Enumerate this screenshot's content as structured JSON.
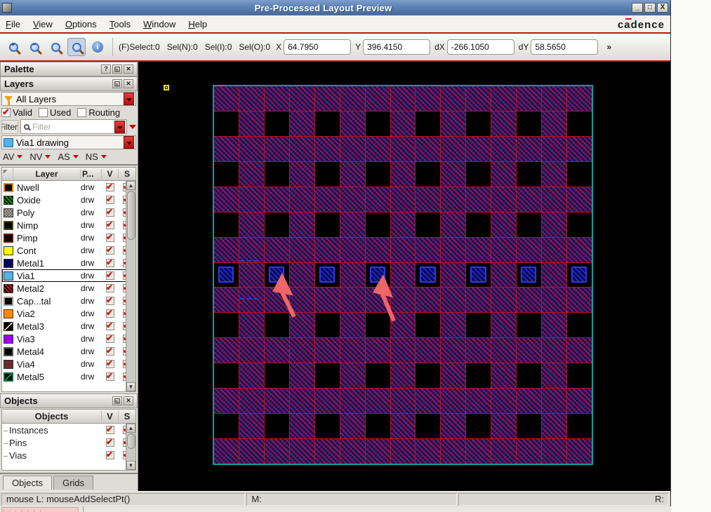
{
  "window": {
    "title": "Pre-Processed Layout Preview",
    "brand": "cadence"
  },
  "titlebar_buttons": {
    "minimize": "_",
    "maximize": "□",
    "close": "X"
  },
  "menu": {
    "items": [
      "File",
      "View",
      "Options",
      "Tools",
      "Window",
      "Help"
    ]
  },
  "toolbar": {
    "icons": [
      "zoom-in",
      "zoom-out",
      "zoom-area",
      "zoom-fit",
      "info"
    ],
    "status_counters": [
      "(F)Select:0",
      "Sel(N):0",
      "Sel(I):0",
      "Sel(O):0"
    ],
    "coord_fields": [
      {
        "label": "X",
        "value": "64.7950"
      },
      {
        "label": "Y",
        "value": "396.4150"
      },
      {
        "label": "dX",
        "value": "-266.1050"
      },
      {
        "label": "dY",
        "value": "58.5650"
      }
    ],
    "overflow_label": "»"
  },
  "palette": {
    "title": "Palette",
    "header_buttons": [
      "?",
      "◱",
      "✕"
    ],
    "layers_panel": {
      "title": "Layers",
      "header_buttons": [
        "◱",
        "✕"
      ],
      "layer_filter_value": "All Layers",
      "checkboxes": [
        {
          "label": "Valid",
          "checked": true
        },
        {
          "label": "Used",
          "checked": false
        },
        {
          "label": "Routing",
          "checked": false
        }
      ],
      "filter_side_label": "Filter",
      "filter_placeholder": "Filter",
      "active_layer_value": "Via1 drawing",
      "quick_buttons": [
        "AV",
        "NV",
        "AS",
        "NS"
      ],
      "table": {
        "headers": [
          "Layer",
          "P...",
          "V",
          "S"
        ],
        "rows": [
          {
            "name": "Nwell",
            "purpose": "drw",
            "v": true,
            "s": true,
            "swatch": "nwell"
          },
          {
            "name": "Oxide",
            "purpose": "drw",
            "v": true,
            "s": true,
            "swatch": "oxide"
          },
          {
            "name": "Poly",
            "purpose": "drw",
            "v": true,
            "s": true,
            "swatch": "poly"
          },
          {
            "name": "Nimp",
            "purpose": "drw",
            "v": true,
            "s": true,
            "swatch": "nimp"
          },
          {
            "name": "Pimp",
            "purpose": "drw",
            "v": true,
            "s": true,
            "swatch": "pimp"
          },
          {
            "name": "Cont",
            "purpose": "drw",
            "v": true,
            "s": true,
            "swatch": "cont"
          },
          {
            "name": "Metal1",
            "purpose": "drw",
            "v": true,
            "s": true,
            "swatch": "metal1"
          },
          {
            "name": "Via1",
            "purpose": "drw",
            "v": true,
            "s": true,
            "swatch": "via1",
            "selected": true
          },
          {
            "name": "Metal2",
            "purpose": "drw",
            "v": true,
            "s": true,
            "swatch": "metal2"
          },
          {
            "name": "Cap...tal",
            "purpose": "drw",
            "v": true,
            "s": true,
            "swatch": "captal"
          },
          {
            "name": "Via2",
            "purpose": "drw",
            "v": true,
            "s": true,
            "swatch": "via2"
          },
          {
            "name": "Metal3",
            "purpose": "drw",
            "v": true,
            "s": true,
            "swatch": "metal3"
          },
          {
            "name": "Via3",
            "purpose": "drw",
            "v": true,
            "s": true,
            "swatch": "via3"
          },
          {
            "name": "Metal4",
            "purpose": "drw",
            "v": true,
            "s": true,
            "swatch": "metal4"
          },
          {
            "name": "Via4",
            "purpose": "drw",
            "v": true,
            "s": true,
            "swatch": "via4"
          },
          {
            "name": "Metal5",
            "purpose": "drw",
            "v": true,
            "s": true,
            "swatch": "metal5"
          }
        ]
      }
    },
    "objects_panel": {
      "title": "Objects",
      "header_buttons": [
        "◱",
        "✕"
      ],
      "table_headers": [
        "Objects",
        "V",
        "S"
      ],
      "rows": [
        {
          "name": "Instances",
          "v": true,
          "s": true
        },
        {
          "name": "Pins",
          "v": true,
          "s": true
        },
        {
          "name": "Vias",
          "v": true,
          "s": true
        }
      ]
    },
    "tabs": [
      {
        "label": "Objects",
        "active": true
      },
      {
        "label": "Grids",
        "active": false
      }
    ]
  },
  "canvas": {
    "grid": {
      "rows": 15,
      "cols": 15,
      "via_row": 8,
      "black_rule": "even-rows-odd-cols",
      "via_count": 8
    },
    "annotations": {
      "arrows_point_to_via_columns": [
        3,
        7
      ]
    },
    "colors": {
      "background": "#000000",
      "boundary": "#0a9f9f",
      "grid_lines": "#b01425",
      "hatch_base": "#181050",
      "via_outline": "#2a35e0",
      "arrow": "#f06565",
      "origin_marker": "#e8e800"
    }
  },
  "statusbar": {
    "left": "mouse L: mouseAddSelectPt()",
    "middle": "M:",
    "right": "R:"
  }
}
